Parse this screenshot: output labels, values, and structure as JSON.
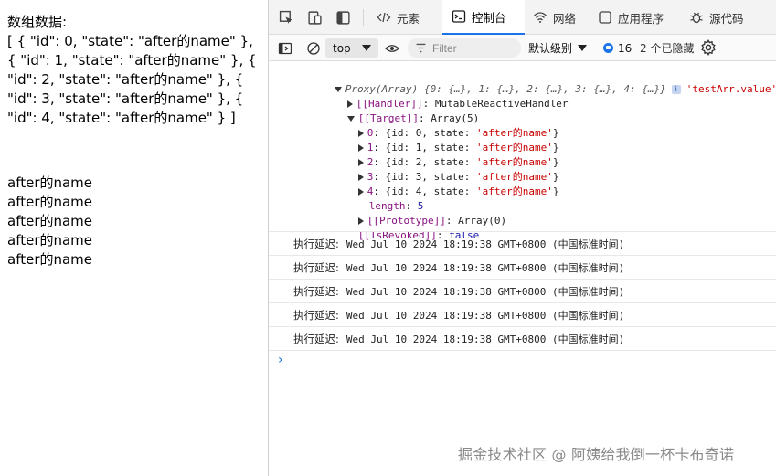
{
  "page": {
    "data_text": "数组数据:\n[ { \"id\": 0, \"state\": \"after的name\" }, { \"id\": 1, \"state\": \"after的name\" }, { \"id\": 2, \"state\": \"after的name\" }, { \"id\": 3, \"state\": \"after的name\" }, { \"id\": 4, \"state\": \"after的name\" } ]",
    "names": [
      "after的name",
      "after的name",
      "after的name",
      "after的name",
      "after的name"
    ]
  },
  "devtools": {
    "tabs": {
      "elements": "元素",
      "console": "控制台",
      "network": "网络",
      "application": "应用程序",
      "sources": "源代码"
    },
    "filterbar": {
      "context": "top",
      "filter_placeholder": "Filter",
      "level": "默认级别",
      "issues_count": "16",
      "hidden": "2 个已隐藏"
    },
    "console": {
      "proxy_summary": "Proxy(Array) {0: {…}, 1: {…}, 2: {…}, 3: {…}, 4: {…}}",
      "proxy_label": "'testArr.value'",
      "handler_key": "[[Handler]]",
      "handler_value": "MutableReactiveHandler",
      "target_key": "[[Target]]",
      "target_value": "Array(5)",
      "items": [
        {
          "index": "0",
          "body": "{id: 0, state: ",
          "state": "'after的name'",
          "close": "}"
        },
        {
          "index": "1",
          "body": "{id: 1, state: ",
          "state": "'after的name'",
          "close": "}"
        },
        {
          "index": "2",
          "body": "{id: 2, state: ",
          "state": "'after的name'",
          "close": "}"
        },
        {
          "index": "3",
          "body": "{id: 3, state: ",
          "state": "'after的name'",
          "close": "}"
        },
        {
          "index": "4",
          "body": "{id: 4, state: ",
          "state": "'after的name'",
          "close": "}"
        }
      ],
      "length_key": "length",
      "length_value": "5",
      "prototype_key": "[[Prototype]]",
      "prototype_value": "Array(0)",
      "revoked_key": "[[IsRevoked]]",
      "revoked_value": "false",
      "logs": [
        {
          "label": "执行延迟:",
          "value": "Wed Jul 10 2024 18:19:38 GMT+0800 (中国标准时间)"
        },
        {
          "label": "执行延迟:",
          "value": "Wed Jul 10 2024 18:19:38 GMT+0800 (中国标准时间)"
        },
        {
          "label": "执行延迟:",
          "value": "Wed Jul 10 2024 18:19:38 GMT+0800 (中国标准时间)"
        },
        {
          "label": "执行延迟:",
          "value": "Wed Jul 10 2024 18:19:38 GMT+0800 (中国标准时间)"
        },
        {
          "label": "执行延迟:",
          "value": "Wed Jul 10 2024 18:19:38 GMT+0800 (中国标准时间)"
        }
      ],
      "prompt": "›"
    }
  },
  "watermark": "掘金技术社区 @ 阿姨给我倒一杯卡布奇诺",
  "colors": {
    "accent": "#1a73e8",
    "key": "#881280",
    "string": "#c80000",
    "number": "#1a1aa6"
  }
}
